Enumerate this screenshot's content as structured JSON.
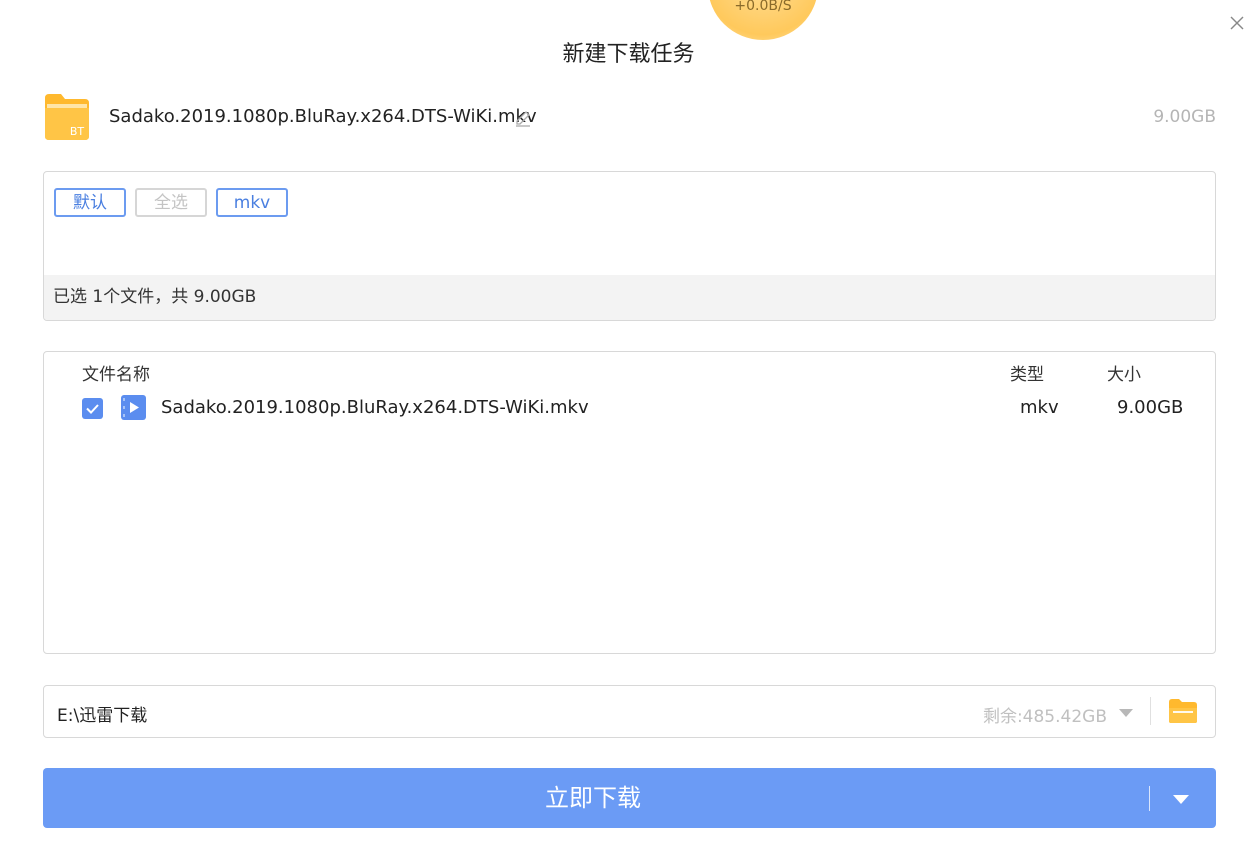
{
  "speed": {
    "text": "+0.0B/S"
  },
  "dialog": {
    "title": "新建下载任务"
  },
  "task": {
    "name": "Sadako.2019.1080p.BluRay.x264.DTS-WiKi.mkv",
    "size": "9.00GB",
    "icon_label": "BT"
  },
  "filters": {
    "chips": [
      {
        "label": "默认",
        "state": "active"
      },
      {
        "label": "全选",
        "state": "disabled"
      },
      {
        "label": "mkv",
        "state": "active"
      }
    ],
    "selection_summary": "已选 1个文件，共 9.00GB"
  },
  "file_list": {
    "columns": {
      "name": "文件名称",
      "type": "类型",
      "size": "大小"
    },
    "rows": [
      {
        "checked": true,
        "name": "Sadako.2019.1080p.BluRay.x264.DTS-WiKi.mkv",
        "type": "mkv",
        "size": "9.00GB"
      }
    ]
  },
  "save_path": {
    "path": "E:\\迅雷下载",
    "remaining": "剩余:485.42GB"
  },
  "download_button": {
    "label": "立即下载"
  },
  "colors": {
    "accent": "#6b9bf5",
    "checkbox": "#5b8def",
    "folder": "#ffc144"
  },
  "icons": [
    "close-icon",
    "bt-folder-icon",
    "edit-icon",
    "video-file-icon",
    "folder-icon",
    "chevron-down-icon"
  ]
}
